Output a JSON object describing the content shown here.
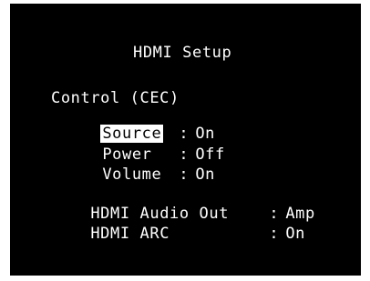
{
  "menu": {
    "title": "HDMI Setup",
    "control_section": {
      "label": "Control (CEC)",
      "items": [
        {
          "name": "Source",
          "value": "On",
          "selected": true
        },
        {
          "name": "Power",
          "value": "Off",
          "selected": false
        },
        {
          "name": "Volume",
          "value": "On",
          "selected": false
        }
      ]
    },
    "settings": [
      {
        "name": "HDMI Audio Out",
        "value": "Amp"
      },
      {
        "name": "HDMI ARC",
        "value": "On"
      }
    ],
    "separator": ":"
  }
}
